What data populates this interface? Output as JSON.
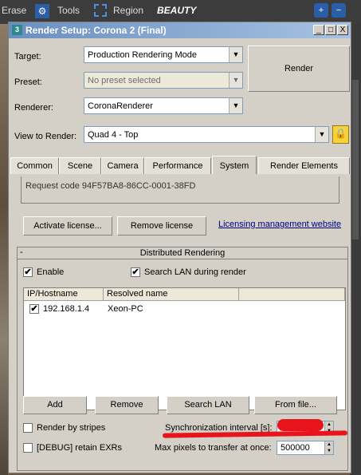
{
  "host": {
    "toolbar": {
      "erase": "Erase",
      "tools": "Tools",
      "region": "Region",
      "beauty": "BEAUTY"
    }
  },
  "window": {
    "title": "Render Setup: Corona 2 (Final)",
    "buttons": {
      "minimize": "_",
      "maximize": "□",
      "close": "X"
    }
  },
  "form": {
    "target_label": "Target:",
    "target_value": "Production Rendering Mode",
    "preset_label": "Preset:",
    "preset_value": "No preset selected",
    "renderer_label": "Renderer:",
    "renderer_value": "CoronaRenderer",
    "view_label": "View to Render:",
    "view_value": "Quad 4 - Top",
    "render_button": "Render"
  },
  "tabs": [
    "Common",
    "Scene",
    "Camera",
    "Performance",
    "System",
    "Render Elements"
  ],
  "active_tab": "System",
  "license": {
    "request_code": "Request code 94F57BA8-86CC-0001-38FD",
    "activate": "Activate license...",
    "remove": "Remove license",
    "website": "Licensing management website"
  },
  "dr": {
    "title": "Distributed Rendering",
    "collapse": "-",
    "enable": "Enable",
    "enable_checked": true,
    "search_lan": "Search LAN during render",
    "search_lan_checked": true,
    "columns": [
      "IP/Hostname",
      "Resolved name"
    ],
    "rows": [
      {
        "checked": true,
        "ip": "192.168.1.4",
        "name": "Xeon-PC"
      }
    ],
    "buttons": {
      "add": "Add",
      "remove": "Remove",
      "search": "Search LAN",
      "from_file": "From file..."
    },
    "render_stripes": "Render by stripes",
    "sync_label": "Synchronization interval [s]:",
    "debug_exr": "[DEBUG] retain EXRs",
    "max_pixels_label": "Max pixels to transfer at once:",
    "max_pixels_value": "500000"
  },
  "colors": {
    "title_start": "#6a8fbf",
    "title_end": "#a7c2e2",
    "annotation": "#e8141b",
    "lock": "#f6d23c"
  }
}
